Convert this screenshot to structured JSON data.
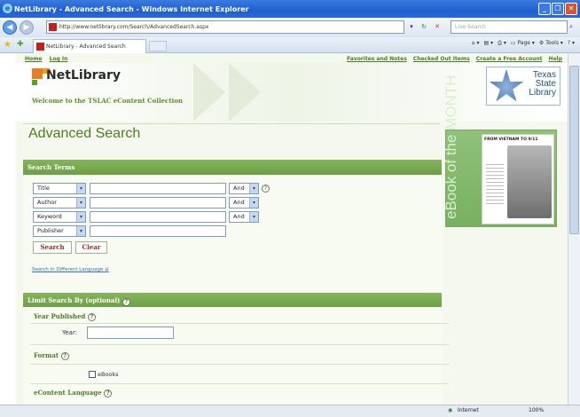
{
  "window": {
    "title": "NetLibrary - Advanced Search - Windows Internet Explorer"
  },
  "browser": {
    "url": "http://www.netlibrary.com/Search/AdvancedSearch.aspx",
    "search_placeholder": "Live Search",
    "tab_title": "NetLibrary - Advanced Search",
    "commands": [
      "Page",
      "Tools"
    ],
    "status_zone": "Internet",
    "zoom": "100%"
  },
  "site": {
    "top_links": [
      "Home",
      "Log In"
    ],
    "right_links": [
      "Favorites and Notes",
      "Checked Out Items",
      "Create a Free Account",
      "Help"
    ],
    "logo": "NetLibrary",
    "welcome": "Welcome to the TSLAC eContent Collection",
    "partner": {
      "line1": "Texas",
      "line2": "State",
      "line3": "Library"
    },
    "page_title": "Advanced Search",
    "search_terms_heading": "Search Terms",
    "rows": [
      {
        "field": "Title",
        "op": "And"
      },
      {
        "field": "Author",
        "op": "And"
      },
      {
        "field": "Keyword",
        "op": "And"
      },
      {
        "field": "Publisher",
        "op": ""
      }
    ],
    "search_button": "Search",
    "clear_button": "Clear",
    "diff_language_link": "Search in Different Language",
    "limit_heading": "Limit Search By (optional)",
    "year_published": "Year Published",
    "year_label": "Year:",
    "format": "Format",
    "ebooks": "eBooks",
    "econtent_language": "eContent Language",
    "promo": {
      "text": "eBook of the MONTH",
      "book_title": "FROM VIETNAM TO 9/11"
    }
  }
}
